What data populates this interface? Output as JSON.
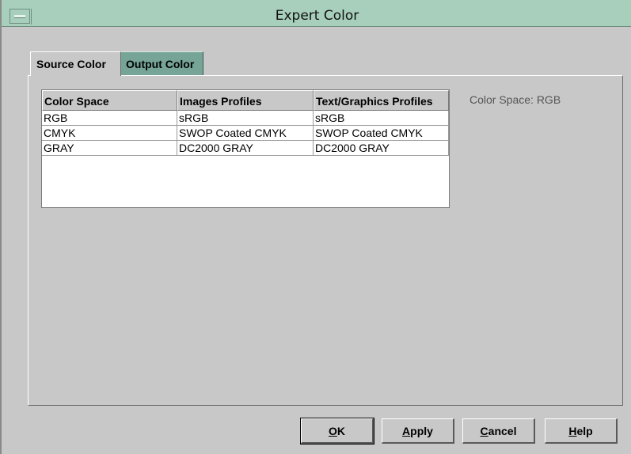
{
  "window": {
    "title": "Expert Color"
  },
  "tabs": [
    {
      "label": "Source Color",
      "active": true
    },
    {
      "label": "Output Color",
      "active": false
    }
  ],
  "table": {
    "columns": [
      "Color Space",
      "Images Profiles",
      "Text/Graphics Profiles"
    ],
    "rows": [
      [
        "RGB",
        "sRGB",
        "sRGB"
      ],
      [
        "CMYK",
        "SWOP Coated CMYK",
        "SWOP Coated CMYK"
      ],
      [
        "GRAY",
        "DC2000 GRAY",
        "DC2000 GRAY"
      ]
    ]
  },
  "info": {
    "color_space_label": "Color Space: RGB"
  },
  "buttons": {
    "ok": {
      "mnemonic": "O",
      "rest": "K"
    },
    "apply": {
      "mnemonic": "A",
      "rest": "pply"
    },
    "cancel": {
      "mnemonic": "C",
      "rest": "ancel"
    },
    "help": {
      "mnemonic": "H",
      "rest": "elp"
    }
  },
  "colors": {
    "titlebar": "#a7cfbc",
    "inactive_tab": "#76a598",
    "window_bg": "#c8c8c8"
  }
}
